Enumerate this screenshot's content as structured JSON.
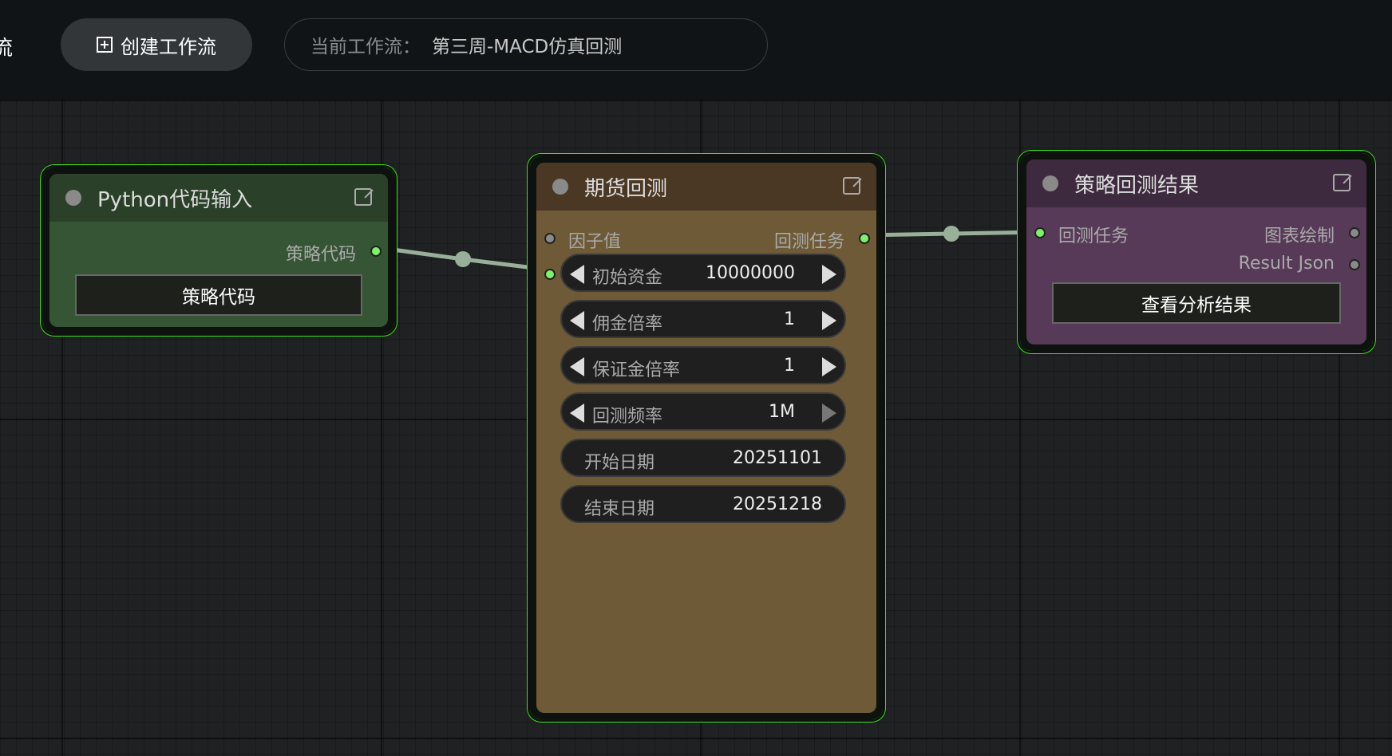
{
  "topbar": {
    "cut_title": "流",
    "create_button_label": "创建工作流",
    "current_workflow_label": "当前工作流：",
    "current_workflow_value": "第三周-MACD仿真回测"
  },
  "nodes": {
    "python_input": {
      "title": "Python代码输入",
      "output_slot": "策略代码",
      "button_label": "策略代码"
    },
    "futures_backtest": {
      "title": "期货回测",
      "input_slot": "因子值",
      "output_slot": "回测任务",
      "widgets": [
        {
          "label": "初始资金",
          "value": "10000000"
        },
        {
          "label": "佣金倍率",
          "value": "1"
        },
        {
          "label": "保证金倍率",
          "value": "1"
        },
        {
          "label": "回测频率",
          "value": "1M"
        },
        {
          "label": "开始日期",
          "value": "20251101"
        },
        {
          "label": "结束日期",
          "value": "20251218"
        }
      ]
    },
    "backtest_result": {
      "title": "策略回测结果",
      "input_slot": "回测任务",
      "output_slot_1": "图表绘制",
      "output_slot_2": "Result Json",
      "button_label": "查看分析结果"
    }
  },
  "colors": {
    "selection_outline": "#3be21a",
    "python_node_body": "#355534",
    "python_node_header": "#2a4029",
    "backtest_node_body": "#6e5a36",
    "backtest_node_header": "#4b3824",
    "result_node_body": "#573a58",
    "result_node_header": "#3e2a3f",
    "link_color": "#98b09a"
  }
}
